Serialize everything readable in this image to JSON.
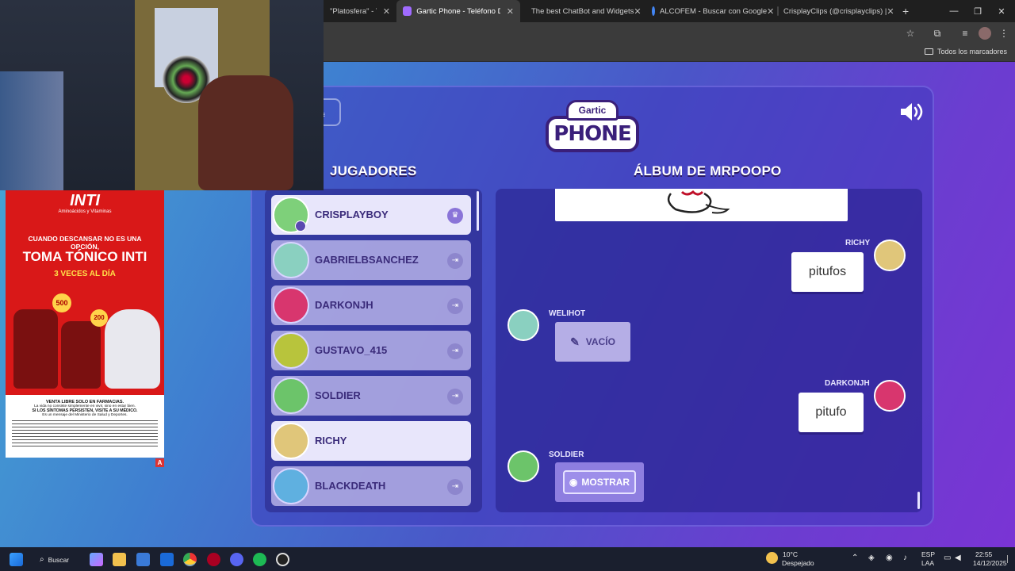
{
  "browser": {
    "tabs": [
      {
        "label": "\"Platosfera\" - You",
        "icon_color": "#ff0000"
      },
      {
        "label": "Gartic Phone - Teléfono De",
        "icon_color": "#a06bff",
        "active": true
      },
      {
        "label": "The best ChatBot and Widgets",
        "icon_color": "#ffffff"
      },
      {
        "label": "ALCOFEM - Buscar con Google",
        "icon_color": "#4285f4"
      },
      {
        "label": "CrisplayClips (@crisplayclips) |",
        "icon_color": "#111111"
      }
    ],
    "new_tab": "+",
    "bookmarks_all": "Todos los marcadores"
  },
  "game": {
    "logo_top": "Gartic",
    "logo_bottom": "PHONE",
    "players_title": "JUGADORES",
    "album_title": "ÁLBUM DE MRPOOPO",
    "players": [
      {
        "name": "CRISPLAYBOY",
        "avatar_color": "#7ed07a",
        "icon": "crown-icon",
        "glyph": "♛",
        "highlight": true
      },
      {
        "name": "GABRIELBSANCHEZ",
        "avatar_color": "#8ad0c0",
        "icon": "exit-icon",
        "glyph": "⇥"
      },
      {
        "name": "DARKONJH",
        "avatar_color": "#d8366e",
        "icon": "exit-icon",
        "glyph": "⇥"
      },
      {
        "name": "GUSTAVO_415",
        "avatar_color": "#b8c43c",
        "icon": "exit-icon",
        "glyph": "⇥"
      },
      {
        "name": "SOLDIER",
        "avatar_color": "#6cc46a",
        "icon": "exit-icon",
        "glyph": "⇥"
      },
      {
        "name": "RICHY",
        "avatar_color": "#e0c67a",
        "icon": "",
        "glyph": "",
        "highlight": true
      },
      {
        "name": "BLACKDEATH",
        "avatar_color": "#5fb0e0",
        "icon": "exit-icon",
        "glyph": "⇥"
      }
    ],
    "album": {
      "entries": [
        {
          "name": "RICHY",
          "text": "pitufos"
        },
        {
          "name": "WELIHOT",
          "text": "VACÍO"
        },
        {
          "name": "DARKONJH",
          "text": "pitufo"
        },
        {
          "name": "SOLDIER",
          "button": "MOSTRAR"
        }
      ]
    }
  },
  "ad": {
    "brand": "INTI",
    "tagline": "Aminoácidos y Vitaminas",
    "headline1": "CUANDO DESCANSAR NO ES UNA OPCIÓN,",
    "headline2": "TOMA TÓNICO INTI",
    "headline3": "3 VECES AL DÍA",
    "badge1": "500",
    "badge2": "200",
    "legal1": "VENTA LIBRE SOLO EN FARMACIAS.",
    "legal2": "La vida no consiste simplemente en vivir, sino en estar bien.",
    "legal3": "SI LOS SÍNTOMAS PERSISTEN, VISITE A SU MÉDICO.",
    "legal4": "Es un mensaje del Ministerio de Salud y Deportes.",
    "ad_mark": "A"
  },
  "taskbar": {
    "search": "Buscar",
    "weather_temp": "10°C",
    "weather_desc": "Despejado",
    "lang1": "ESP",
    "lang2": "LAA",
    "time": "22:55",
    "date": "14/12/2025"
  }
}
